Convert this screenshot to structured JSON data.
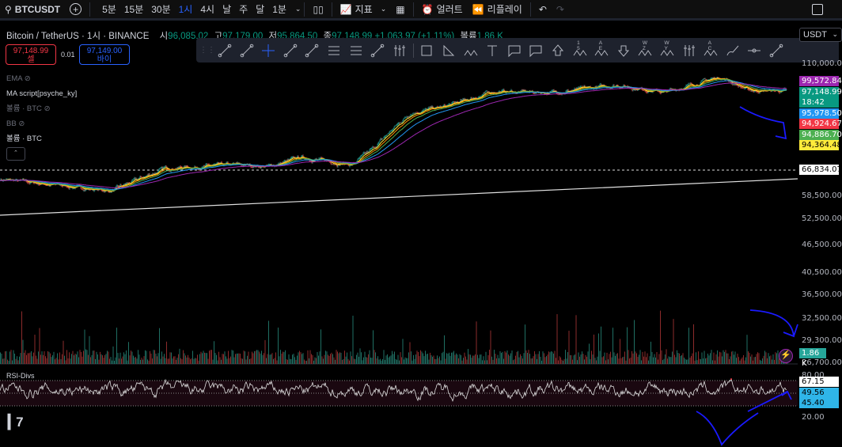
{
  "topbar": {
    "symbol": "BTCUSDT",
    "timeframes": [
      "5분",
      "15분",
      "30분",
      "1시",
      "4시",
      "날",
      "주",
      "달",
      "1분"
    ],
    "active_timeframe": "1시",
    "indicators_label": "지표",
    "alert_label": "얼러트",
    "replay_label": "리플레이"
  },
  "legend": {
    "title": "Bitcoin / TetherUS · 1시 · BINANCE",
    "o_label": "시",
    "o": "96,085.02",
    "h_label": "고",
    "h": "97,179.00",
    "l_label": "저",
    "l": "95,864.50",
    "c_label": "종",
    "c": "97,148.99",
    "change": "+1,063.97 (+1.11%)",
    "vol_label": "볼륨",
    "vol": "1.86 K"
  },
  "order": {
    "sell_price": "97,148.99",
    "sell_label": "셀",
    "spread": "0.01",
    "buy_price": "97,149.00",
    "buy_label": "바이"
  },
  "indicators": [
    {
      "name": "EMA"
    },
    {
      "name": "MA script[psyche_ky]"
    },
    {
      "name": "볼륨 · BTC"
    },
    {
      "name": "BB"
    },
    {
      "name": "볼륨 · BTC"
    }
  ],
  "drawing_tools": {
    "wave_labels": [
      "1 5",
      "A E",
      "W Z",
      "W Y",
      "A C"
    ]
  },
  "currency": "USDT",
  "price_axis": [
    "110,000.00",
    "58,500.00",
    "52,500.00",
    "46,500.00",
    "40,500.00",
    "36,500.00",
    "32,500.00",
    "29,300.00",
    "26,700.00"
  ],
  "price_tags": [
    {
      "value": "99,572.84",
      "color": "#9c27b0"
    },
    {
      "value": "97,148.99",
      "sub": "18:42",
      "color": "#089981"
    },
    {
      "value": "95,978.50",
      "color": "#2196f3"
    },
    {
      "value": "94,924.67",
      "color": "#f23645"
    },
    {
      "value": "94,886.70",
      "color": "#4caf50"
    },
    {
      "value": "94,364.48",
      "color": "#ffeb3b"
    }
  ],
  "line_tag": "66,834.07",
  "volume_tag": "1.86 K",
  "rsi": {
    "label": "RSI-Divs",
    "axis": [
      "80.00",
      "20.00"
    ],
    "tags": [
      "67.15",
      "49.56",
      "45.40"
    ]
  },
  "chart_data": {
    "type": "candlestick",
    "symbol": "BTCUSDT",
    "interval": "1h",
    "price_waypoints": [
      [
        0,
        64000
      ],
      [
        60,
        62500
      ],
      [
        140,
        60500
      ],
      [
        210,
        67500
      ],
      [
        300,
        68500
      ],
      [
        340,
        68000
      ],
      [
        380,
        71000
      ],
      [
        445,
        68500
      ],
      [
        470,
        73500
      ],
      [
        520,
        88000
      ],
      [
        560,
        90000
      ],
      [
        625,
        97000
      ],
      [
        700,
        96500
      ],
      [
        780,
        100000
      ],
      [
        840,
        96500
      ],
      [
        910,
        104000
      ],
      [
        945,
        97500
      ],
      [
        993,
        97149
      ]
    ],
    "horizontal_line": 66834.07,
    "last": 97148.99
  }
}
